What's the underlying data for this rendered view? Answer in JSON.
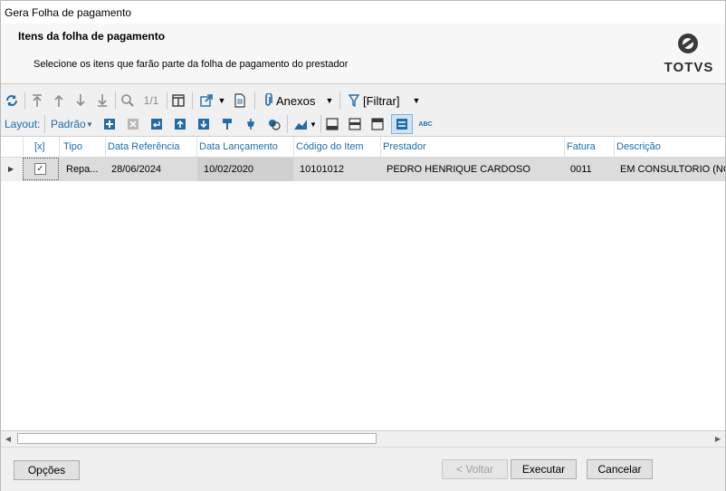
{
  "window": {
    "title": "Gera Folha de pagamento"
  },
  "header": {
    "title": "Itens da folha de pagamento",
    "subtitle": "Selecione os itens que farão parte da folha de pagamento do prestador",
    "logo_text": "TOTVS"
  },
  "toolbar": {
    "record_counter": "1/1",
    "attachments_label": "Anexos",
    "filter_label": "[Filtrar]",
    "layout_label": "Layout:",
    "layout_value": "Padrão"
  },
  "grid": {
    "columns": [
      "[x]",
      "Tipo",
      "Data Referência",
      "Data Lançamento",
      "Código do Item",
      "Prestador",
      "Fatura",
      "Descrição"
    ],
    "rows": [
      {
        "selected": true,
        "tipo": "Repa...",
        "data_referencia": "28/06/2024",
        "data_lancamento": "10/02/2020",
        "codigo_item": "10101012",
        "prestador": "PEDRO HENRIQUE CARDOSO",
        "fatura": "0011",
        "descricao": "EM CONSULTORIO (NO H"
      }
    ]
  },
  "buttons": {
    "options": "Opções",
    "back": "< Voltar",
    "execute": "Executar",
    "cancel": "Cancelar"
  },
  "colors": {
    "accent": "#1f6ca8",
    "selected_row": "#dcdcdc"
  }
}
